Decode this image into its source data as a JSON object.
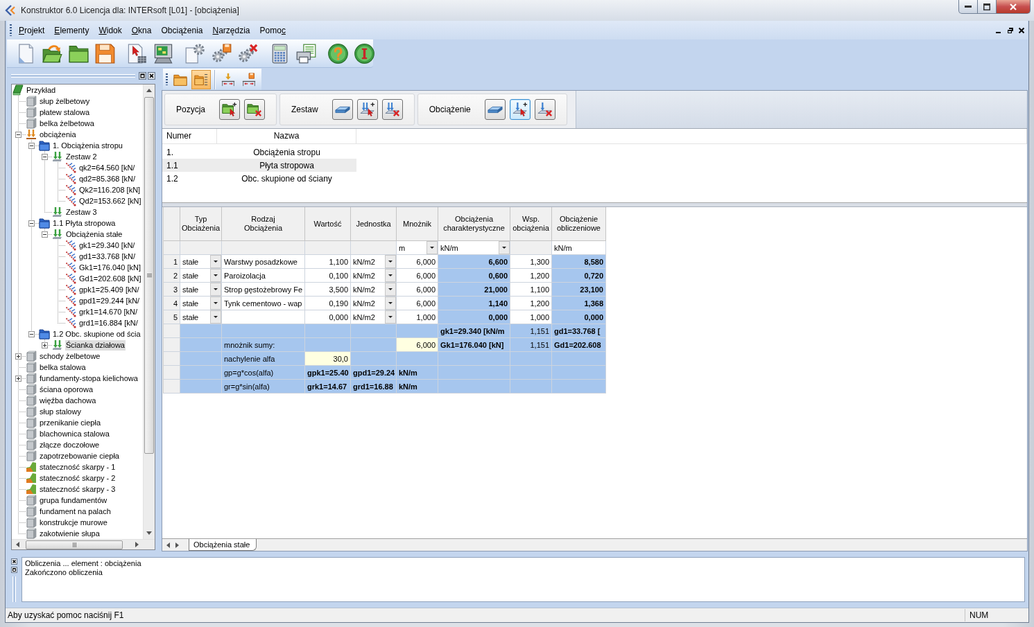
{
  "window": {
    "title": "Konstruktor 6.0 Licencja dla: INTERsoft [L01] - [obciążenia]"
  },
  "menu": [
    {
      "accelerator": "P",
      "after": "rojekt"
    },
    {
      "accelerator": "E",
      "after": "lementy"
    },
    {
      "accelerator": "W",
      "after": "idok"
    },
    {
      "accelerator": "O",
      "after": "kna"
    },
    {
      "before": "Obciążenia"
    },
    {
      "accelerator": "N",
      "after": "arzędzia"
    },
    {
      "before": "Pomo",
      "accelerator": "c"
    }
  ],
  "toolbar": [
    {
      "kind": "new-document"
    },
    {
      "kind": "open-folder"
    },
    {
      "kind": "folder"
    },
    {
      "kind": "save"
    },
    {
      "kind": "separator"
    },
    {
      "kind": "document-cursor"
    },
    {
      "kind": "monitor"
    },
    {
      "kind": "separator"
    },
    {
      "kind": "document-gear"
    },
    {
      "kind": "gears-save"
    },
    {
      "kind": "gears-delete"
    },
    {
      "kind": "separator"
    },
    {
      "kind": "calculator"
    },
    {
      "kind": "printer"
    },
    {
      "kind": "separator"
    },
    {
      "kind": "help"
    },
    {
      "kind": "info"
    }
  ],
  "tree": [
    {
      "label": "Przykład",
      "kind": "project",
      "selected": false,
      "children": [
        {
          "label": "słup żelbetowy",
          "kind": "element",
          "selected": false
        },
        {
          "label": "płatew stalowa",
          "kind": "element",
          "selected": false
        },
        {
          "label": "belka żelbetowa",
          "kind": "element",
          "selected": false
        },
        {
          "label": "obciążenia",
          "kind": "loads",
          "selected": false,
          "expanded": true,
          "children": [
            {
              "label": "1. Obciążenia stropu",
              "kind": "folder",
              "selected": false,
              "expanded": true,
              "children": [
                {
                  "label": "Zestaw 2",
                  "kind": "set",
                  "selected": false,
                  "expanded": true,
                  "children": [
                    {
                      "label": "qk2=64.560 [kN/",
                      "kind": "load",
                      "selected": false
                    },
                    {
                      "label": "qd2=85.368 [kN/",
                      "kind": "load",
                      "selected": false
                    },
                    {
                      "label": "Qk2=116.208 [kN]",
                      "kind": "load",
                      "selected": false
                    },
                    {
                      "label": "Qd2=153.662 [kN]",
                      "kind": "load",
                      "selected": false
                    }
                  ]
                },
                {
                  "label": "Zestaw 3",
                  "kind": "set",
                  "selected": false
                }
              ]
            },
            {
              "label": "1.1 Płyta stropowa",
              "kind": "folder",
              "selected": false,
              "expanded": true,
              "children": [
                {
                  "label": "Obciążenia stałe",
                  "kind": "set",
                  "selected": false,
                  "expanded": true,
                  "children": [
                    {
                      "label": "gk1=29.340 [kN/",
                      "kind": "load",
                      "selected": false
                    },
                    {
                      "label": "gd1=33.768 [kN/",
                      "kind": "load",
                      "selected": false
                    },
                    {
                      "label": "Gk1=176.040 [kN]",
                      "kind": "load",
                      "selected": false
                    },
                    {
                      "label": "Gd1=202.608 [kN]",
                      "kind": "load",
                      "selected": false
                    },
                    {
                      "label": "gpk1=25.409 [kN/",
                      "kind": "load",
                      "selected": false
                    },
                    {
                      "label": "gpd1=29.244 [kN/",
                      "kind": "load",
                      "selected": false
                    },
                    {
                      "label": "grk1=14.670 [kN/",
                      "kind": "load",
                      "selected": false
                    },
                    {
                      "label": "grd1=16.884 [kN/",
                      "kind": "load",
                      "selected": false
                    }
                  ]
                }
              ]
            },
            {
              "label": "1.2 Obc. skupione od ścia",
              "kind": "folder",
              "selected": false,
              "expanded": true,
              "children": [
                {
                  "label": "Ścianka działowa",
                  "kind": "set",
                  "selected": true,
                  "expanded": false
                }
              ]
            }
          ]
        },
        {
          "label": "schody żelbetowe",
          "kind": "element",
          "selected": false,
          "expanded": false
        },
        {
          "label": "belka stalowa",
          "kind": "element",
          "selected": false
        },
        {
          "label": "fundamenty-stopa kielichowa",
          "kind": "element",
          "selected": false,
          "expanded": false
        },
        {
          "label": "ściana oporowa",
          "kind": "element",
          "selected": false
        },
        {
          "label": "więźba dachowa",
          "kind": "element",
          "selected": false
        },
        {
          "label": "słup stalowy",
          "kind": "element",
          "selected": false
        },
        {
          "label": "przenikanie ciepła",
          "kind": "element",
          "selected": false
        },
        {
          "label": "blachownica stalowa",
          "kind": "element",
          "selected": false
        },
        {
          "label": "złącze doczołowe",
          "kind": "element",
          "selected": false
        },
        {
          "label": "zapotrzebowanie ciepła",
          "kind": "element",
          "selected": false
        },
        {
          "label": "stateczność skarpy - 1",
          "kind": "slope",
          "selected": false
        },
        {
          "label": "stateczność skarpy - 2",
          "kind": "slope",
          "selected": false
        },
        {
          "label": "stateczność skarpy - 3",
          "kind": "slope",
          "selected": false
        },
        {
          "label": "grupa fundamentów",
          "kind": "element",
          "selected": false
        },
        {
          "label": "fundament na palach",
          "kind": "element",
          "selected": false
        },
        {
          "label": "konstrukcje murowe",
          "kind": "element",
          "selected": false
        },
        {
          "label": "zakotwienie słupa",
          "kind": "element",
          "selected": false
        }
      ]
    }
  ],
  "view_toolbar": [
    {
      "kind": "folder-orange",
      "selected": false
    },
    {
      "kind": "folder-list",
      "selected": true
    },
    {
      "kind": "separator"
    },
    {
      "kind": "load-insert",
      "selected": false
    },
    {
      "kind": "load-save",
      "selected": false
    }
  ],
  "panel_groups": [
    {
      "label": "Pozycja",
      "buttons": [
        {
          "kind": "folder-add",
          "active": false
        },
        {
          "kind": "folder-delete",
          "active": false
        }
      ]
    },
    {
      "label": "Zestaw",
      "buttons": [
        {
          "kind": "layer",
          "active": false
        },
        {
          "kind": "loads-add",
          "active": false
        },
        {
          "kind": "loads-delete",
          "active": false
        }
      ]
    },
    {
      "label": "Obciążenie",
      "buttons": [
        {
          "kind": "layer",
          "active": false
        },
        {
          "kind": "load-add",
          "active": true
        },
        {
          "kind": "load-delete",
          "active": false
        }
      ]
    }
  ],
  "positions": {
    "columns": [
      "Numer",
      "Nazwa"
    ],
    "rows": [
      {
        "number": "1.",
        "name": "Obciążenia stropu",
        "selected": false
      },
      {
        "number": "1.1",
        "name": "Płyta stropowa",
        "selected": true
      },
      {
        "number": "1.2",
        "name": "Obc. skupione od ściany",
        "selected": false
      }
    ]
  },
  "grid": {
    "columns": [
      "",
      "Typ\nObciażenia",
      "Rodzaj\nObciążenia",
      "Wartość",
      "Jednostka",
      "Mnożnik",
      "Obciążenia\ncharakterystyczne",
      "Wsp.\nobciążenia",
      "Obciążenie\nobliczeniowe"
    ],
    "rows": [
      {
        "cells": [
          {
            "kind": "blank"
          },
          {
            "kind": "blank"
          },
          {
            "kind": "blank"
          },
          {
            "kind": "blank"
          },
          {
            "kind": "blank"
          },
          {
            "kind": "select",
            "text": "m"
          },
          {
            "kind": "select",
            "text": "kN/m"
          },
          {
            "kind": "blank"
          },
          {
            "kind": "text",
            "text": "kN/m"
          }
        ]
      },
      {
        "cells": [
          {
            "kind": "rownum",
            "text": "1"
          },
          {
            "kind": "select",
            "text": "stałe"
          },
          {
            "kind": "text",
            "text": "Warstwy posadzkowe"
          },
          {
            "kind": "number",
            "text": "1,100"
          },
          {
            "kind": "select",
            "text": "kN/m2"
          },
          {
            "kind": "number",
            "text": "6,000"
          },
          {
            "kind": "calc",
            "text": "6,600"
          },
          {
            "kind": "number",
            "text": "1,300"
          },
          {
            "kind": "calc",
            "text": "8,580"
          }
        ]
      },
      {
        "cells": [
          {
            "kind": "rownum",
            "text": "2"
          },
          {
            "kind": "select",
            "text": "stałe"
          },
          {
            "kind": "text",
            "text": "Paroizolacja"
          },
          {
            "kind": "number",
            "text": "0,100"
          },
          {
            "kind": "select",
            "text": "kN/m2"
          },
          {
            "kind": "number",
            "text": "6,000"
          },
          {
            "kind": "calc",
            "text": "0,600"
          },
          {
            "kind": "number",
            "text": "1,200"
          },
          {
            "kind": "calc",
            "text": "0,720"
          }
        ]
      },
      {
        "cells": [
          {
            "kind": "rownum",
            "text": "3"
          },
          {
            "kind": "select",
            "text": "stałe"
          },
          {
            "kind": "text",
            "text": "Strop gęstożebrowy Fe"
          },
          {
            "kind": "number",
            "text": "3,500"
          },
          {
            "kind": "select",
            "text": "kN/m2"
          },
          {
            "kind": "number",
            "text": "6,000"
          },
          {
            "kind": "calc",
            "text": "21,000"
          },
          {
            "kind": "number",
            "text": "1,100"
          },
          {
            "kind": "calc",
            "text": "23,100"
          }
        ]
      },
      {
        "cells": [
          {
            "kind": "rownum",
            "text": "4"
          },
          {
            "kind": "select",
            "text": "stałe"
          },
          {
            "kind": "text",
            "text": "Tynk cementowo - wap"
          },
          {
            "kind": "number",
            "text": "0,190"
          },
          {
            "kind": "select",
            "text": "kN/m2"
          },
          {
            "kind": "number",
            "text": "6,000"
          },
          {
            "kind": "calc",
            "text": "1,140"
          },
          {
            "kind": "number",
            "text": "1,200"
          },
          {
            "kind": "calc",
            "text": "1,368"
          }
        ]
      },
      {
        "cells": [
          {
            "kind": "rownum",
            "text": "5"
          },
          {
            "kind": "select",
            "text": "stałe"
          },
          {
            "kind": "text"
          },
          {
            "kind": "number",
            "text": "0,000"
          },
          {
            "kind": "select",
            "text": "kN/m2"
          },
          {
            "kind": "number",
            "text": "1,000"
          },
          {
            "kind": "calc",
            "text": "0,000"
          },
          {
            "kind": "number",
            "text": "1,000"
          },
          {
            "kind": "calc",
            "text": "0,000"
          }
        ]
      },
      {
        "cells": [
          {
            "kind": "blank"
          },
          {
            "kind": "fill"
          },
          {
            "kind": "fill"
          },
          {
            "kind": "fill"
          },
          {
            "kind": "fill"
          },
          {
            "kind": "fill"
          },
          {
            "kind": "result",
            "text": "gk1=29.340 [kN/m"
          },
          {
            "kind": "value",
            "text": "1,151"
          },
          {
            "kind": "result",
            "text": "gd1=33.768 ["
          }
        ]
      },
      {
        "cells": [
          {
            "kind": "blank"
          },
          {
            "kind": "fill"
          },
          {
            "kind": "label",
            "text": "mnożnik sumy:"
          },
          {
            "kind": "fill"
          },
          {
            "kind": "fill"
          },
          {
            "kind": "input",
            "text": "6,000"
          },
          {
            "kind": "result",
            "text": "Gk1=176.040 [kN]"
          },
          {
            "kind": "value",
            "text": "1,151"
          },
          {
            "kind": "result",
            "text": "Gd1=202.608"
          }
        ]
      },
      {
        "cells": [
          {
            "kind": "blank"
          },
          {
            "kind": "fill"
          },
          {
            "kind": "label",
            "text": "nachylenie alfa"
          },
          {
            "kind": "input",
            "text": "30,0"
          },
          {
            "kind": "fill"
          },
          {
            "kind": "fill"
          },
          {
            "kind": "fill"
          },
          {
            "kind": "fill"
          },
          {
            "kind": "fill"
          }
        ]
      },
      {
        "cells": [
          {
            "kind": "blank"
          },
          {
            "kind": "fill"
          },
          {
            "kind": "label",
            "text": "gp=g*cos(alfa)"
          },
          {
            "kind": "result",
            "text": "gpk1=25.40"
          },
          {
            "kind": "result",
            "text": "gpd1=29.24"
          },
          {
            "kind": "result",
            "text": "kN/m"
          },
          {
            "kind": "fill"
          },
          {
            "kind": "fill"
          },
          {
            "kind": "fill"
          }
        ]
      },
      {
        "cells": [
          {
            "kind": "blank"
          },
          {
            "kind": "fill"
          },
          {
            "kind": "label",
            "text": "gr=g*sin(alfa)"
          },
          {
            "kind": "result",
            "text": "grk1=14.67"
          },
          {
            "kind": "result",
            "text": "grd1=16.88"
          },
          {
            "kind": "result",
            "text": "kN/m"
          },
          {
            "kind": "fill"
          },
          {
            "kind": "fill"
          },
          {
            "kind": "fill"
          }
        ]
      }
    ]
  },
  "sheet_tabs": [
    {
      "label": "Obciążenia stałe",
      "selected": true
    }
  ],
  "output": {
    "lines": [
      "Obliczenia ... element : obciążenia",
      "Zakończono obliczenia"
    ]
  },
  "status_bar": {
    "message": "Aby uzyskać pomoc naciśnij F1",
    "indicators": [
      "NUM"
    ]
  }
}
